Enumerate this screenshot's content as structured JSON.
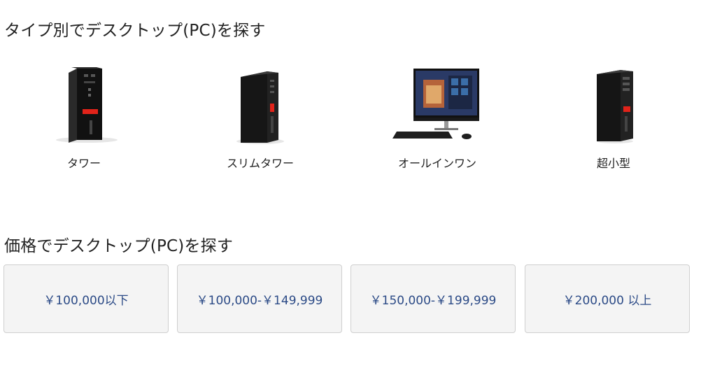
{
  "sections": {
    "by_type": {
      "title": "タイプ別でデスクトップ(PC)を探す",
      "items": [
        {
          "label": "タワー",
          "icon": "tower-pc-icon"
        },
        {
          "label": "スリムタワー",
          "icon": "slim-tower-pc-icon"
        },
        {
          "label": "オールインワン",
          "icon": "all-in-one-pc-icon"
        },
        {
          "label": "超小型",
          "icon": "tiny-pc-icon"
        }
      ]
    },
    "by_price": {
      "title": "価格でデスクトップ(PC)を探す",
      "buttons": [
        {
          "label": "￥100,000以下"
        },
        {
          "label": "￥100,000-￥149,999"
        },
        {
          "label": "￥150,000-￥199,999"
        },
        {
          "label": "￥200,000 以上"
        }
      ]
    }
  },
  "colors": {
    "price_text": "#2b4a86",
    "price_bg": "#f4f4f4",
    "price_border": "#cfcfcf",
    "brand_red": "#e2231a"
  }
}
